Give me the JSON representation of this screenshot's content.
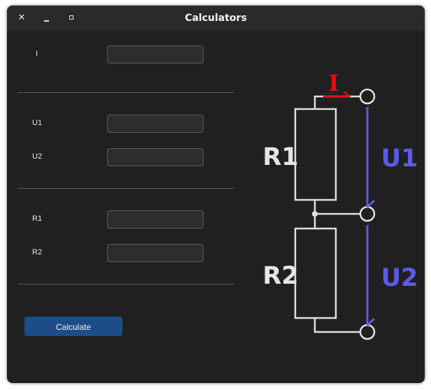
{
  "window": {
    "title": "Calculators",
    "close_glyph": "✕"
  },
  "fields": {
    "current_label": "I",
    "current_value": "",
    "u1_label": "U1",
    "u1_value": "",
    "u2_label": "U2",
    "u2_value": "",
    "r1_label": "R1",
    "r1_value": "",
    "r2_label": "R2",
    "r2_value": ""
  },
  "actions": {
    "calculate_label": "Calculate"
  },
  "diagram": {
    "current_label": "I",
    "r1_label": "R1",
    "r2_label": "R2",
    "u1_label": "U1",
    "u2_label": "U2",
    "colors": {
      "wire": "#e0e0e0",
      "current": "#e01010",
      "voltage": "#5b5be6",
      "resistor_text": "#e6e6e6"
    }
  },
  "colors": {
    "window_bg": "#202020",
    "titlebar_bg": "#2a2a2a",
    "button_bg": "#1c4d86"
  }
}
